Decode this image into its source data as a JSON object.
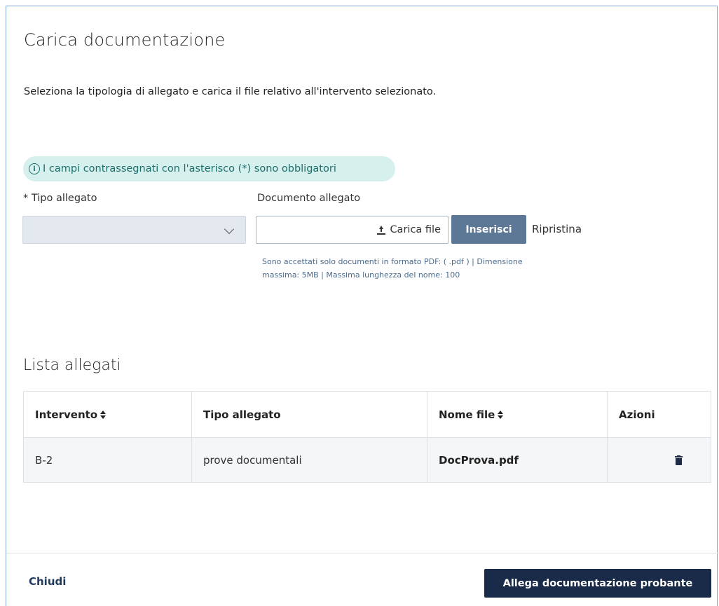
{
  "dialog": {
    "title": "Carica documentazione",
    "intro": "Seleziona la tipologia di allegato e carica il file relativo all'intervento selezionato."
  },
  "notice": {
    "icon": "info-icon",
    "text": "I campi contrassegnati con l'asterisco (*) sono obbligatori"
  },
  "form": {
    "tipo_label": "* Tipo allegato",
    "tipo_value": "",
    "doc_label": "Documento allegato",
    "upload_label": "Carica file",
    "insert_label": "Inserisci",
    "reset_label": "Ripristina",
    "hint_line1": "Sono accettati solo documenti in formato PDF: ( .pdf )  |  Dimensione",
    "hint_line2": "massima: 5MB  |  Massima lunghezza del nome: 100"
  },
  "list": {
    "title": "Lista allegati",
    "columns": [
      "Intervento",
      "Tipo allegato",
      "Nome file",
      "Azioni"
    ],
    "rows": [
      {
        "intervento": "B-2",
        "tipo": "prove documentali",
        "nome_file": "DocProva.pdf",
        "azione_icon": "trash-icon"
      }
    ]
  },
  "footer": {
    "close_label": "Chiudi",
    "submit_label": "Allega documentazione probante"
  },
  "colors": {
    "primary": "#1a2b4a",
    "secondary_button": "#5d7797",
    "notice_bg": "#d6f0ee",
    "notice_text": "#1d6d6a"
  }
}
